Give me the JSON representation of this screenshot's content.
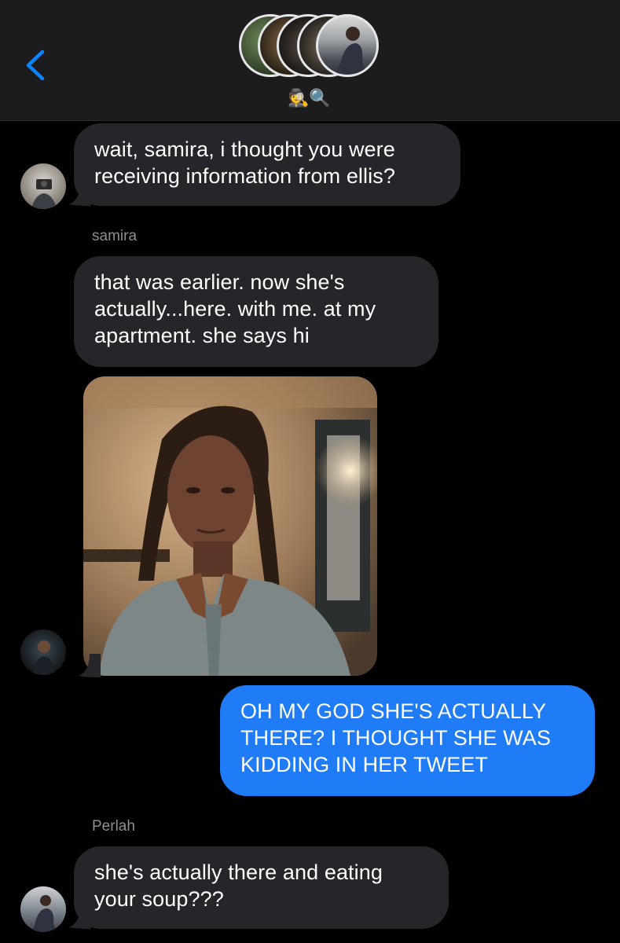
{
  "header": {
    "back_icon": "chevron-left-icon",
    "group_emoji": "🕵🔍",
    "accent_color": "#0a84ff",
    "group_avatars": [
      "avatar-1",
      "avatar-2",
      "avatar-3",
      "avatar-4",
      "avatar-5"
    ]
  },
  "messages": [
    {
      "type": "text",
      "direction": "incoming",
      "text_lines": [
        "wait, samira, i thought you were",
        "receiving information from ellis?"
      ]
    },
    {
      "type": "text",
      "direction": "incoming",
      "sender": "samira",
      "text_lines": [
        "that was earlier. now she's",
        "actually...here. with me. at my",
        "apartment. she says hi"
      ]
    },
    {
      "type": "image",
      "direction": "incoming",
      "alt": "photo"
    },
    {
      "type": "text",
      "direction": "outgoing",
      "text_lines": [
        "OH MY GOD SHE'S ACTUALLY",
        "THERE? I THOUGHT SHE WAS",
        "KIDDING IN HER TWEET"
      ]
    },
    {
      "type": "text",
      "direction": "incoming",
      "sender": "Perlah",
      "text_lines": [
        "she's actually there and eating",
        "your soup???"
      ]
    }
  ],
  "colors": {
    "incoming_bubble": "#26252a",
    "outgoing_bubble": "#1f7cf6",
    "background": "#000000",
    "header": "#1c1c1e",
    "sender_name": "#8e8e93"
  }
}
